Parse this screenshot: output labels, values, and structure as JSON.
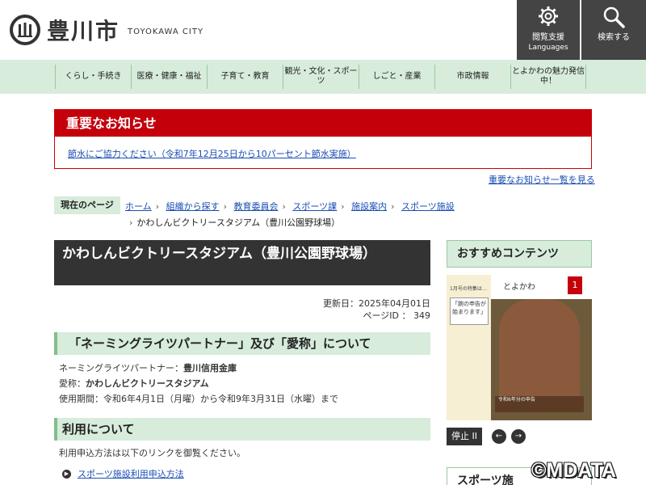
{
  "header": {
    "logo_text": "豊川市",
    "logo_sub": "TOYOKAWA CITY",
    "browse_support_label": "閲覧支援",
    "languages_label": "Languages",
    "search_label": "検索する"
  },
  "nav": {
    "items": [
      {
        "label": "くらし・手続き"
      },
      {
        "label": "医療・健康・福祉"
      },
      {
        "label": "子育て・教育"
      },
      {
        "label": "観光・文化・スポーツ"
      },
      {
        "label": "しごと・産業"
      },
      {
        "label": "市政情報"
      },
      {
        "label": "とよかわの魅力発信中！"
      }
    ]
  },
  "notice": {
    "title": "重要なお知らせ",
    "link": "節水にご協力ください（令和7年12月25日から10パーセント節水実施）",
    "all_link": "重要なお知らせ一覧を見る"
  },
  "breadcrumb": {
    "label": "現在のページ",
    "items": [
      "ホーム",
      "組織から探す",
      "教育委員会",
      "スポーツ課",
      "施設案内",
      "スポーツ施設"
    ],
    "current": "かわしんビクトリースタジアム（豊川公園野球場）"
  },
  "main": {
    "title": "かわしんビクトリースタジアム（豊川公園野球場）",
    "updated": "更新日：2025年04月01日",
    "page_id": "ページID ： 349",
    "section1": {
      "heading": "「ネーミングライツパートナー」及び「愛称」について",
      "line1_label": "ネーミングライツパートナー：",
      "line1_value": "豊川信用金庫",
      "line2_label": "愛称：",
      "line2_value": "かわしんビクトリースタジアム",
      "line3": "使用期間：令和6年4月1日（月曜）から令和9年3月31日（水曜）まで"
    },
    "section2": {
      "heading": "利用について",
      "text": "利用申込方法は以下のリンクを御覧ください。",
      "link": "スポーツ施設利用申込方法"
    }
  },
  "sidebar": {
    "heading": "おすすめコンテンツ",
    "promo": {
      "cover_title": "とよかわ",
      "issue": "1",
      "small_text": "1月号の特集は…",
      "bubble_text": "「腕の申告が始まります」",
      "badge_text": "令和6年分の申告"
    },
    "stop_label": "停止 II",
    "prev_label": "←",
    "next_label": "→",
    "heading2": "スポーツ施"
  },
  "watermark": "©MDATA"
}
